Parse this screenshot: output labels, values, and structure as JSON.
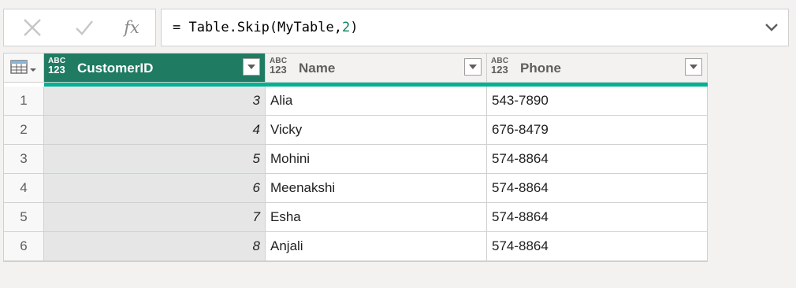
{
  "formula_bar": {
    "cancel_icon": "close-icon",
    "commit_icon": "check-icon",
    "fx_label": "fx",
    "formula_prefix": "= Table.Skip(MyTable,",
    "formula_number": "2",
    "formula_suffix": ")"
  },
  "grid": {
    "columns": [
      {
        "name": "CustomerID",
        "type_top": "ABC",
        "type_bottom": "123",
        "selected": true
      },
      {
        "name": "Name",
        "type_top": "ABC",
        "type_bottom": "123",
        "selected": false
      },
      {
        "name": "Phone",
        "type_top": "ABC",
        "type_bottom": "123",
        "selected": false
      }
    ],
    "rows": [
      {
        "index": "1",
        "CustomerID": "3",
        "Name": "Alia",
        "Phone": "543-7890"
      },
      {
        "index": "2",
        "CustomerID": "4",
        "Name": "Vicky",
        "Phone": "676-8479"
      },
      {
        "index": "3",
        "CustomerID": "5",
        "Name": "Mohini",
        "Phone": "574-8864"
      },
      {
        "index": "4",
        "CustomerID": "6",
        "Name": "Meenakshi",
        "Phone": "574-8864"
      },
      {
        "index": "5",
        "CustomerID": "7",
        "Name": "Esha",
        "Phone": "574-8864"
      },
      {
        "index": "6",
        "CustomerID": "8",
        "Name": "Anjali",
        "Phone": "574-8864"
      }
    ]
  },
  "colors": {
    "selected_header": "#1f7b62",
    "quality_bar": "#00b294"
  }
}
